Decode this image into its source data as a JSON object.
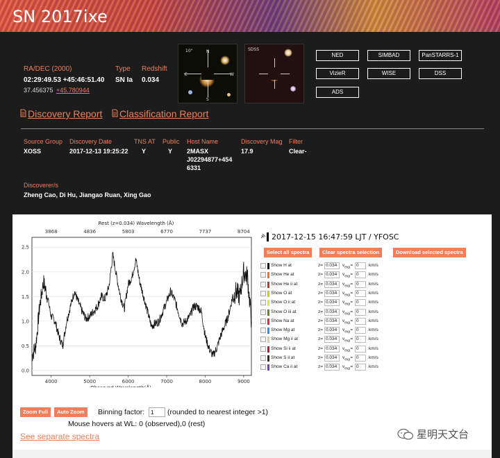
{
  "page": {
    "title": "SN 2017ixe"
  },
  "coords": {
    "label_radec": "RA/DEC (2000)",
    "radec": "02:29:49.53 +45:46:51.40",
    "deg_ra": "37.456375",
    "deg_dec": "+45.780944",
    "label_type": "Type",
    "type": "SN Ia",
    "label_redshift": "Redshift",
    "redshift": "0.034"
  },
  "thumbs": {
    "scale_label": "10\"",
    "n": "N",
    "e": "E",
    "w": "W",
    "s": "S",
    "sdss": "SDSS"
  },
  "external": {
    "buttons": [
      "NED",
      "SIMBAD",
      "PanSTARRS-1",
      "VizieR",
      "WISE",
      "DSS",
      "ADS"
    ]
  },
  "reports": {
    "discovery": "Discovery Report",
    "classification": "Classification Report"
  },
  "details": {
    "cols": [
      {
        "label": "Source Group",
        "value": "XOSS"
      },
      {
        "label": "Discovery Date",
        "value": "2017-12-13 19:25:22"
      },
      {
        "label": "TNS AT",
        "value": "Y"
      },
      {
        "label": "Public",
        "value": "Y"
      },
      {
        "label": "Host Name",
        "value": "2MASX J02294877+4546331",
        "lines": [
          "2MASX",
          "J02294877+454",
          "6331"
        ]
      },
      {
        "label": "Discovery Mag",
        "value": "17.9"
      },
      {
        "label": "Filter",
        "value": "Clear-"
      }
    ],
    "discoverers_label": "Discoverer/s",
    "discoverers": "Zheng Cao, Di Hu, Jiangao Ruan, Xing Gao"
  },
  "spectrum": {
    "header": "2017-12-15 16:47:59 LJT / YFOSC",
    "btn_select_all": "Select all spectra",
    "btn_clear": "Clear spectra selection",
    "btn_download": "Download selected spectra",
    "lines": [
      {
        "name": "Show H at",
        "color": "#111111"
      },
      {
        "name": "Show He at",
        "color": "#e07a2a"
      },
      {
        "name": "Show He ii at",
        "color": "#b8402a"
      },
      {
        "name": "Show O at",
        "color": "#d7c21f"
      },
      {
        "name": "Show O ii at",
        "color": "#e6e04a"
      },
      {
        "name": "Show O iii at",
        "color": "#5a8a2a"
      },
      {
        "name": "Show Na at",
        "color": "#c0392b"
      },
      {
        "name": "Show Mg at",
        "color": "#3c8dd8"
      },
      {
        "name": "Show Mg ii at",
        "color": "#e8c6a0"
      },
      {
        "name": "Show Si ii at",
        "color": "#a0282a"
      },
      {
        "name": "Show S ii at",
        "color": "#3a2418"
      },
      {
        "name": "Show Ca ii at",
        "color": "#7a3cb0"
      }
    ],
    "z_label": "z=",
    "z_value": "0.034",
    "vexp_label": "v",
    "vexp_sub": "exp",
    "vexp_eq": "=",
    "vexp_value": "0",
    "unit": "km/s",
    "zoom_full": "Zoom Full",
    "auto_zoom": "Auto Zoom",
    "binning_label": "Binning factor:",
    "binning_value": "1",
    "binning_note": "(rounded to nearest integer >1)",
    "hover_text": "Mouse hovers at WL: 0 (observed),0 (rest)",
    "see_separate": "See separate spectra"
  },
  "watermark": {
    "text": "星明天文台"
  },
  "chart_data": {
    "type": "line",
    "title": "Rest (z=0.034) Wavelength (Å)",
    "xlabel": "Observed Wavelength(Å)",
    "ylabel": "",
    "xlim": [
      3500,
      9200
    ],
    "ylim": [
      -0.1,
      2.7
    ],
    "x_ticks": [
      4000,
      5000,
      6000,
      7000,
      8000,
      9000
    ],
    "y_ticks": [
      0.0,
      0.5,
      1.0,
      1.5,
      2.0,
      2.5
    ],
    "rest_ticks": [
      3868,
      4836,
      5803,
      6770,
      7737,
      8704
    ],
    "series": [
      {
        "x": [
          3500,
          3600,
          3700,
          3800,
          3900,
          4000,
          4100,
          4200,
          4300,
          4400,
          4500,
          4600,
          4700,
          4800,
          4900,
          5000,
          5100,
          5200,
          5300,
          5400,
          5500,
          5600,
          5700,
          5800,
          5900,
          6000,
          6100,
          6200,
          6300,
          6400,
          6500,
          6600,
          6700,
          6800,
          6900,
          7000,
          7100,
          7200,
          7300,
          7400,
          7500,
          7600,
          7700,
          7800,
          7900,
          8000,
          8100,
          8200,
          8300,
          8400,
          8500,
          8600,
          8700,
          8800,
          8900,
          9000,
          9100,
          9200
        ],
        "values": [
          0.3,
          0.5,
          1.3,
          1.8,
          1.5,
          1.1,
          1.0,
          0.7,
          0.5,
          1.0,
          1.3,
          1.6,
          1.4,
          1.2,
          1.05,
          1.1,
          1.2,
          1.3,
          1.5,
          1.45,
          1.7,
          2.35,
          1.9,
          1.5,
          1.25,
          1.75,
          1.9,
          2.25,
          1.8,
          1.5,
          1.2,
          0.9,
          0.95,
          1.0,
          1.2,
          1.4,
          1.6,
          1.45,
          1.2,
          0.95,
          1.0,
          1.1,
          1.3,
          1.3,
          1.2,
          0.7,
          0.45,
          0.3,
          0.45,
          0.7,
          0.9,
          1.1,
          1.45,
          1.6,
          1.5,
          2.0,
          1.9,
          1.0
        ]
      }
    ]
  }
}
